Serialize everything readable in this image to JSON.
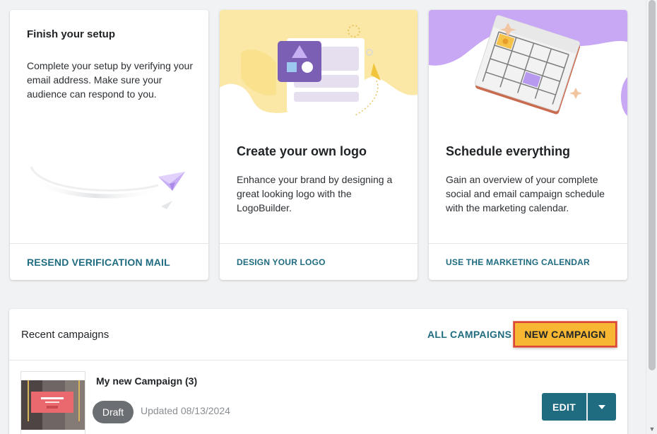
{
  "cards": [
    {
      "title": "Finish your setup",
      "description": "Complete your setup by verifying your email address. Make sure your audience can respond to you.",
      "action": "RESEND VERIFICATION MAIL"
    },
    {
      "title": "Create your own logo",
      "description": "Enhance your brand by designing a great looking logo with the LogoBuilder.",
      "action": "DESIGN YOUR LOGO"
    },
    {
      "title": "Schedule everything",
      "description": "Gain an overview of your complete social and email campaign schedule with the marketing calendar.",
      "action": "USE THE MARKETING CALENDAR"
    }
  ],
  "recent": {
    "title": "Recent campaigns",
    "all_label": "ALL CAMPAIGNS",
    "new_label": "NEW CAMPAIGN",
    "campaign": {
      "name": "My new Campaign (3)",
      "status": "Draft",
      "updated": "Updated 08/13/2024",
      "edit_label": "EDIT"
    }
  },
  "icons": [
    "paper-plane-icon",
    "logo-builder-icon",
    "calendar-icon",
    "chevron-down-icon"
  ],
  "colors": {
    "accent": "#1f6b80",
    "highlight": "#f7b733",
    "highlight_border": "#d9473b",
    "logo_bg": "#fbe8a6",
    "calendar_bg": "#c8a8f5",
    "badge": "#6b6e72"
  }
}
